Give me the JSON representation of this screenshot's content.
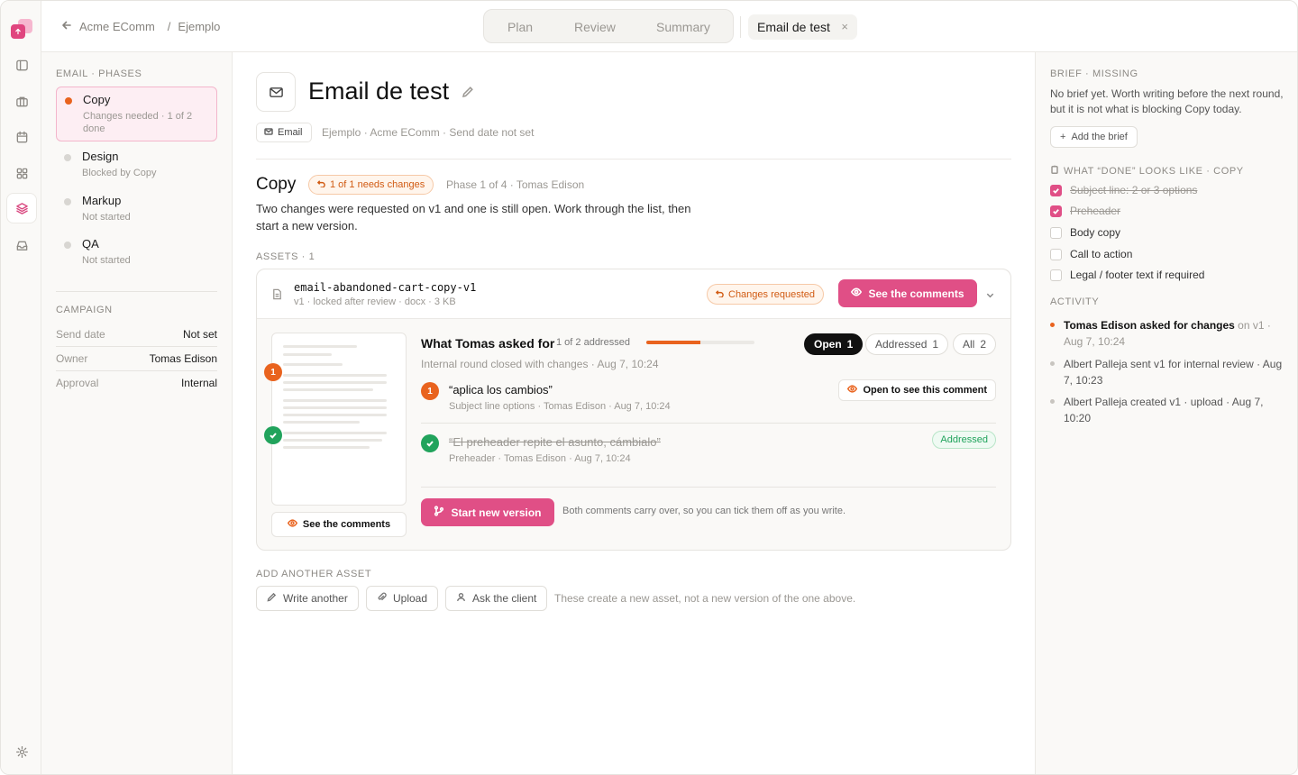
{
  "topbar": {
    "back_label": "Acme EComm",
    "breadcrumb_current": "Ejemplo",
    "tabs": [
      {
        "label": "Plan"
      },
      {
        "label": "Review"
      },
      {
        "label": "Summary"
      }
    ],
    "doc_tab": "Email de test",
    "close_glyph": "×"
  },
  "rail": {
    "icons": [
      "upload-logo-icon",
      "sidebar-toggle-icon",
      "briefcase-icon",
      "calendar-icon",
      "grid-icon",
      "layers-icon",
      "inbox-icon",
      "settings-icon"
    ],
    "active": "layers-icon",
    "accent": "#e04f86"
  },
  "left": {
    "phases_heading": "EMAIL · PHASES",
    "phases": [
      {
        "name": "Copy",
        "status": "Changes needed · 1 of 2 done"
      },
      {
        "name": "Design",
        "status": "Blocked by Copy"
      },
      {
        "name": "Markup",
        "status": "Not started"
      },
      {
        "name": "QA",
        "status": "Not started"
      }
    ],
    "campaign_heading": "CAMPAIGN",
    "campaign": [
      {
        "k": "Send date",
        "v": "Not set"
      },
      {
        "k": "Owner",
        "v": "Tomas Edison"
      },
      {
        "k": "Approval",
        "v": "Internal"
      }
    ]
  },
  "main": {
    "title": "Email de test",
    "type_chip": "Email",
    "meta": "Ejemplo · Acme EComm · Send date not set",
    "phase_title": "Copy",
    "phase_pill": "1 of 1 needs changes",
    "phase_meta": "Phase 1 of 4 · Tomas Edison",
    "phase_desc": "Two changes were requested on v1 and one is still open. Work through the list, then start a new version.",
    "assets_label": "ASSETS · 1",
    "asset": {
      "name": "email-abandoned-cart-copy-v1",
      "meta": "v1 · locked after review · docx · 3 KB",
      "status": "Changes requested",
      "see_comments": "See the comments"
    },
    "review": {
      "title": "What Tomas asked for",
      "addressed_text": "1 of 2 addressed",
      "progress": 0.5,
      "filters": [
        {
          "label": "Open",
          "count": "1"
        },
        {
          "label": "Addressed",
          "count": "1"
        },
        {
          "label": "All",
          "count": "2"
        }
      ],
      "closed_note": "Internal round closed with changes · Aug 7, 10:24",
      "comments": [
        {
          "num": "1",
          "quote": "“aplica los cambios”",
          "meta": "Subject line options · Tomas Edison · Aug 7, 10:24",
          "action": "Open to see this comment"
        },
        {
          "quote": "“El preheader repite el asunto, cámbialo”",
          "meta": "Preheader · Tomas Edison · Aug 7, 10:24",
          "badge": "Addressed"
        }
      ],
      "thumb_see": "See the comments",
      "start_new": "Start new version",
      "carry_note": "Both comments carry over, so you can tick them off as you write."
    },
    "add_asset": {
      "label": "ADD ANOTHER ASSET",
      "buttons": [
        {
          "label": "Write another"
        },
        {
          "label": "Upload"
        },
        {
          "label": "Ask the client"
        }
      ],
      "note": "These create a new asset, not a new version of the one above."
    }
  },
  "right": {
    "brief_heading": "BRIEF · MISSING",
    "brief_text": "No brief yet. Worth writing before the next round, but it is not what is blocking Copy today.",
    "add_brief": "Add the brief",
    "done_heading": "WHAT “DONE” LOOKS LIKE · COPY",
    "checklist": [
      {
        "label": "Subject line: 2 or 3 options",
        "done": true
      },
      {
        "label": "Preheader",
        "done": true
      },
      {
        "label": "Body copy",
        "done": false
      },
      {
        "label": "Call to action",
        "done": false
      },
      {
        "label": "Legal / footer text if required",
        "done": false
      }
    ],
    "activity_heading": "ACTIVITY",
    "activity": [
      {
        "who": "Tomas Edison asked for changes",
        "rest": " on v1 · Aug 7, 10:24"
      },
      {
        "text": "Albert Palleja sent v1 for internal review · Aug 7, 10:23"
      },
      {
        "text": "Albert Palleja created v1 · upload · Aug 7, 10:20"
      }
    ]
  }
}
